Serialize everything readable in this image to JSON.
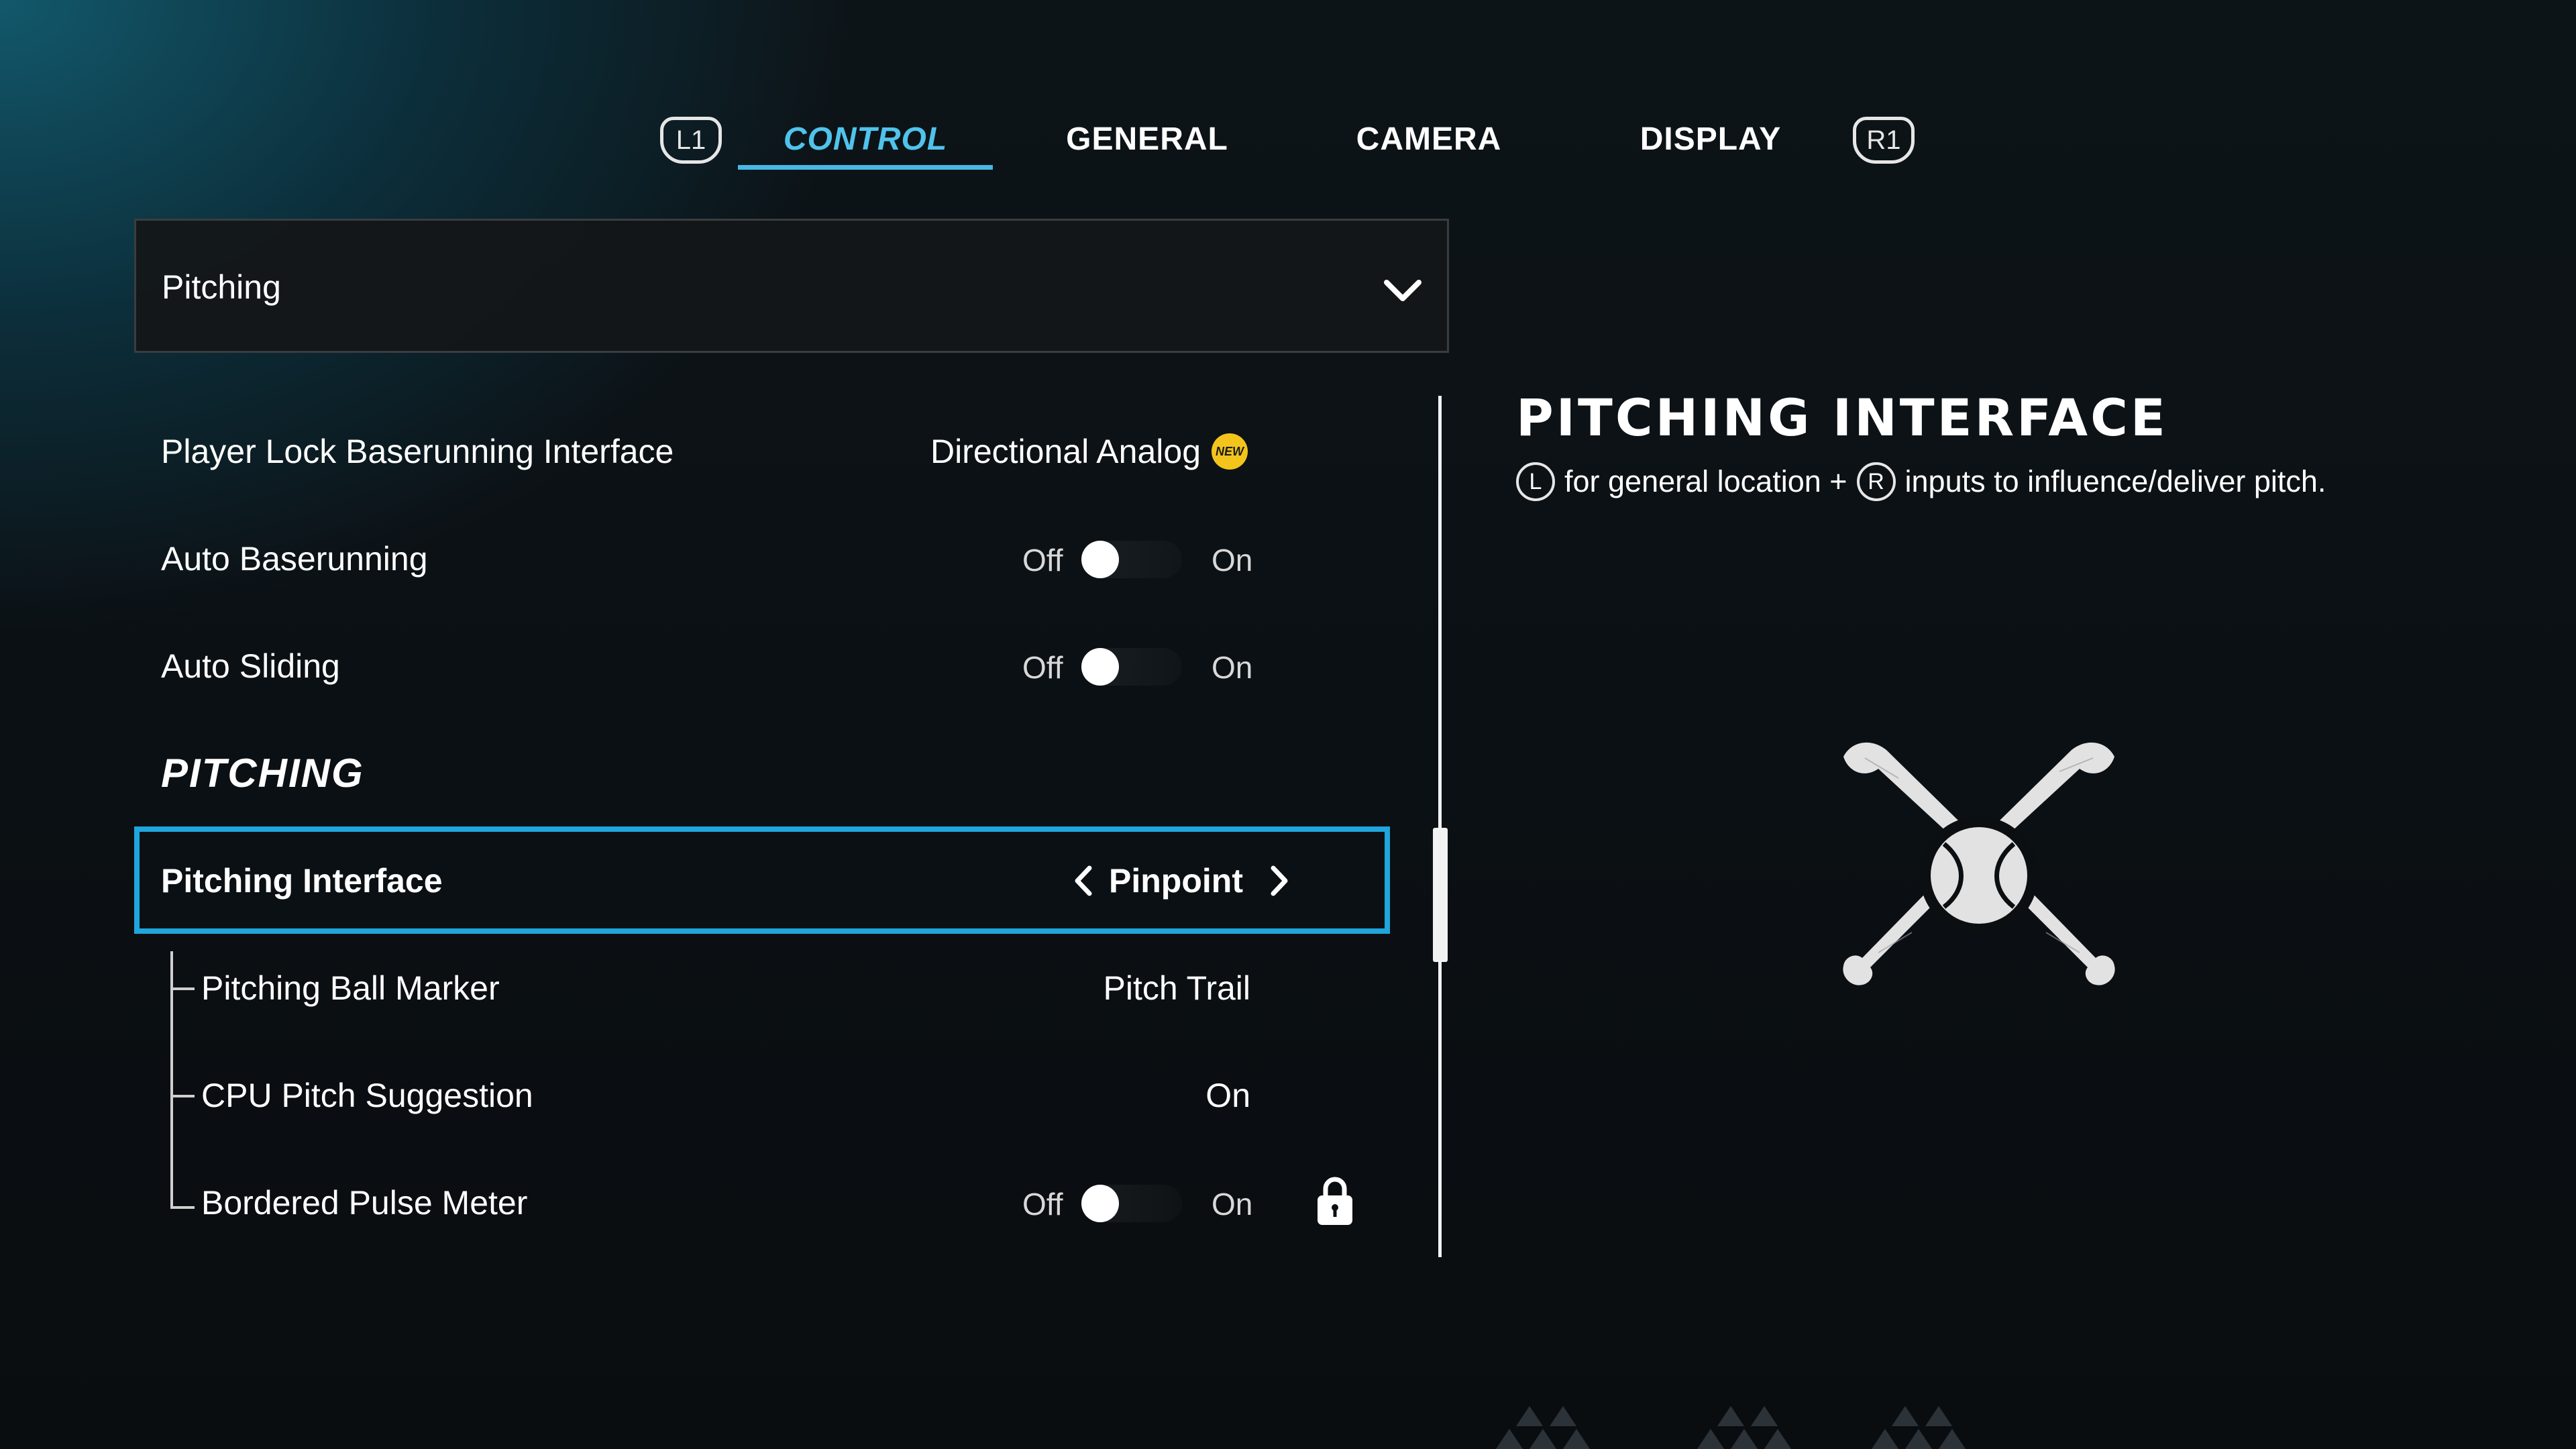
{
  "tabs": {
    "left_bumper": "L1",
    "right_bumper": "R1",
    "items": [
      {
        "label": "CONTROL",
        "active": true
      },
      {
        "label": "GENERAL",
        "active": false
      },
      {
        "label": "CAMERA",
        "active": false
      },
      {
        "label": "DISPLAY",
        "active": false
      }
    ]
  },
  "dropdown": {
    "selected": "Pitching"
  },
  "settings": {
    "player_lock": {
      "label": "Player Lock Baserunning Interface",
      "value": "Directional Analog",
      "badge": "NEW"
    },
    "auto_baserunning": {
      "label": "Auto Baserunning",
      "off": "Off",
      "on": "On",
      "state": "Off"
    },
    "auto_sliding": {
      "label": "Auto Sliding",
      "off": "Off",
      "on": "On",
      "state": "Off"
    },
    "section_pitching": "PITCHING",
    "pitching_interface": {
      "label": "Pitching Interface",
      "value": "Pinpoint"
    },
    "pitching_ball_marker": {
      "label": "Pitching Ball Marker",
      "value": "Pitch Trail"
    },
    "cpu_pitch_suggestion": {
      "label": "CPU Pitch Suggestion",
      "value": "On"
    },
    "bordered_pulse_meter": {
      "label": "Bordered Pulse Meter",
      "off": "Off",
      "on": "On",
      "state": "Off",
      "locked": true
    }
  },
  "info": {
    "title": "PITCHING INTERFACE",
    "left_stick": "L",
    "text_1": "for general location +",
    "right_stick": "R",
    "text_2": "inputs to influence/deliver pitch."
  },
  "colors": {
    "accent": "#47b8e3",
    "selection_border": "#1fa6dc",
    "badge": "#f3c51c"
  },
  "icons": [
    "chevron-down-icon",
    "chevron-left-icon",
    "chevron-right-icon",
    "lock-icon",
    "crossed-bats-baseball-icon"
  ]
}
